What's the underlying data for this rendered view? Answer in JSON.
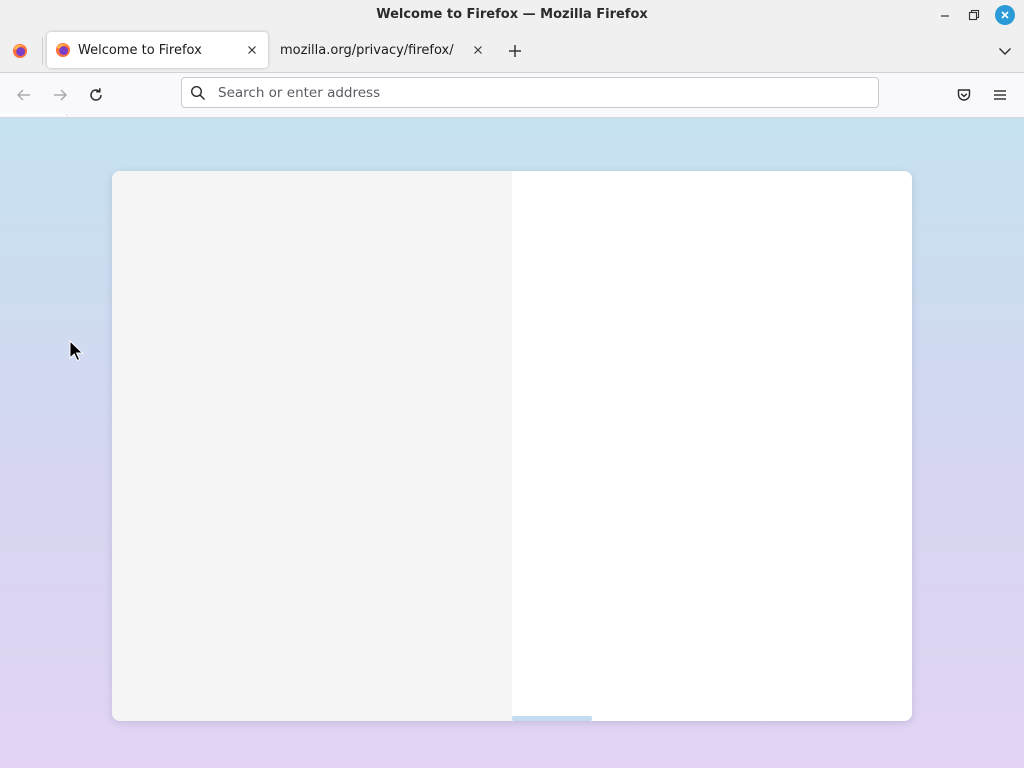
{
  "window": {
    "title": "Welcome to Firefox — Mozilla Firefox"
  },
  "tabs": [
    {
      "label": "Welcome to Firefox",
      "active": true,
      "favicon": "firefox-logo-icon"
    },
    {
      "label": "mozilla.org/privacy/firefox/",
      "active": false,
      "favicon": null
    }
  ],
  "urlbar": {
    "placeholder": "Search or enter address",
    "value": ""
  },
  "colors": {
    "close_button": "#2b9bd8",
    "content_gradient_top": "#c6e2f0",
    "content_gradient_bottom": "#e3d4f4"
  },
  "icons": {
    "window_controls": [
      "minimize-icon",
      "maximize-icon",
      "close-icon"
    ],
    "toolbar": [
      "back-arrow-icon",
      "forward-arrow-icon",
      "reload-icon",
      "search-icon",
      "pocket-icon",
      "hamburger-menu-icon"
    ],
    "tabstrip": [
      "firefox-view-icon",
      "plus-icon",
      "chevron-down-icon"
    ]
  }
}
